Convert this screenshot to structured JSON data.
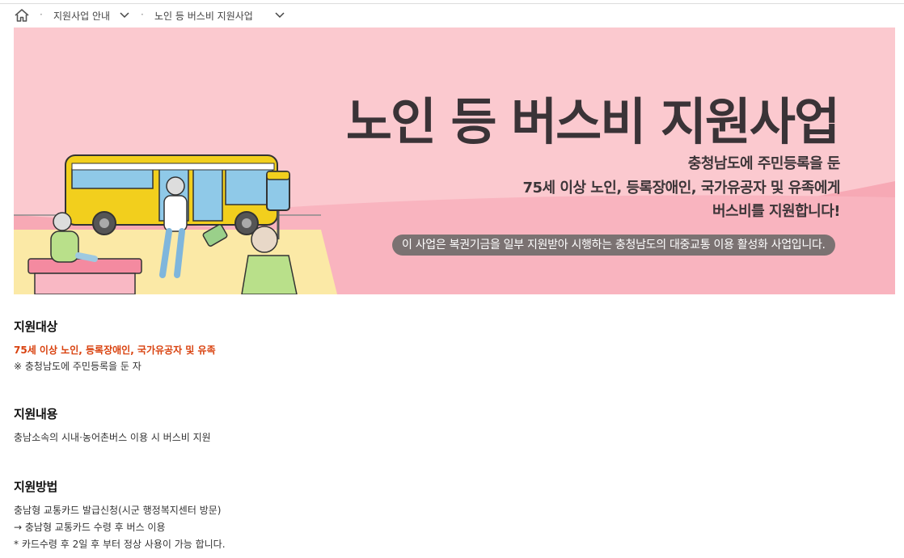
{
  "breadcrumb": {
    "level1": "지원사업 안내",
    "level2": "노인 등 버스비 지원사업"
  },
  "banner": {
    "title": "노인 등 버스비 지원사업",
    "subtitle_lines": [
      "충청남도에 주민등록을 둔",
      "75세 이상 노인, 등록장애인, 국가유공자 및 유족에게",
      "버스비를 지원합니다!"
    ],
    "pill": "이 사업은 복권기금을 일부 지원받아 시행하는 충청남도의 대중교통 이용 활성화 사업입니다.",
    "colors": {
      "background": "#fbc9cf",
      "accent_pink": "#f7a9b5",
      "bus_yellow": "#f2cf1d"
    }
  },
  "sections": {
    "target": {
      "heading": "지원대상",
      "highlight": "75세 이상 노인, 등록장애인, 국가유공자 및 유족",
      "note": "※ 충청남도에 주민등록을 둔 자"
    },
    "content": {
      "heading": "지원내용",
      "line": "충남소속의 시내·농어촌버스 이용 시 버스비 지원"
    },
    "method": {
      "heading": "지원방법",
      "lines": [
        "충남형 교통카드 발급신청(시군 행정복지센터 방문)",
        "→ 충남형 교통카드 수령 후 버스 이용",
        "* 카드수령 후 2일 후 부터 정상 사용이 가능 합니다."
      ]
    }
  },
  "colors": {
    "accent": "#d9420f",
    "pill_bg": "#7b7272"
  },
  "icons": {
    "home": "home-icon",
    "chevron": "chevron-down-icon"
  }
}
